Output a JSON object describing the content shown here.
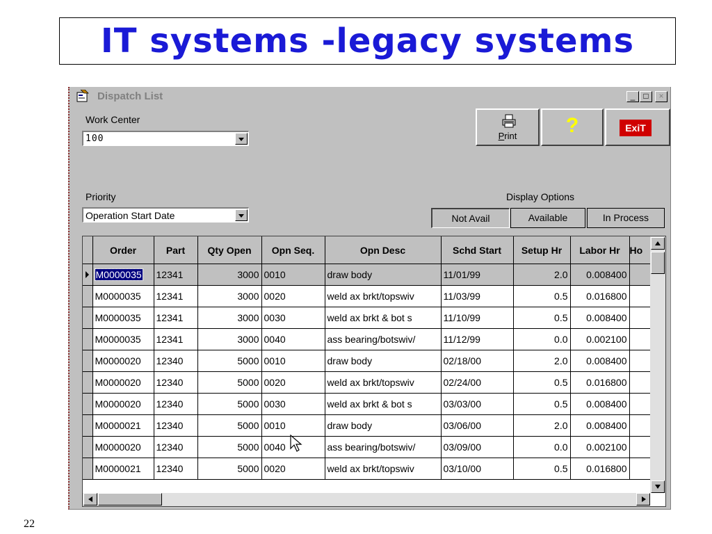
{
  "slide": {
    "title": "IT systems -legacy systems",
    "page_number": "22"
  },
  "window": {
    "title": "Dispatch List",
    "controls": {
      "minimize": "_",
      "maximize": "□",
      "close": "×"
    }
  },
  "work_center": {
    "label": "Work Center",
    "value": "100"
  },
  "priority": {
    "label": "Priority",
    "value": "Operation Start Date"
  },
  "toolbar": {
    "print_label_first": "P",
    "print_label_rest": "rint",
    "help_label": "?",
    "exit_label": "ExiT"
  },
  "display_options": {
    "label": "Display Options",
    "buttons": [
      "Not Avail",
      "Available",
      "In Process"
    ]
  },
  "grid": {
    "columns": [
      "Order",
      "Part",
      "Qty Open",
      "Opn Seq.",
      "Opn Desc",
      "Schd Start",
      "Setup Hr",
      "Labor Hr",
      "Ho"
    ],
    "rows": [
      [
        "M0000035",
        "12341",
        "3000",
        "0010",
        "draw body",
        "11/01/99",
        "2.0",
        "0.008400"
      ],
      [
        "M0000035",
        "12341",
        "3000",
        "0020",
        "weld ax brkt/topswiv",
        "11/03/99",
        "0.5",
        "0.016800"
      ],
      [
        "M0000035",
        "12341",
        "3000",
        "0030",
        "weld ax brkt & bot s",
        "11/10/99",
        "0.5",
        "0.008400"
      ],
      [
        "M0000035",
        "12341",
        "3000",
        "0040",
        "ass bearing/botswiv/",
        "11/12/99",
        "0.0",
        "0.002100"
      ],
      [
        "M0000020",
        "12340",
        "5000",
        "0010",
        "draw body",
        "02/18/00",
        "2.0",
        "0.008400"
      ],
      [
        "M0000020",
        "12340",
        "5000",
        "0020",
        "weld ax brkt/topswiv",
        "02/24/00",
        "0.5",
        "0.016800"
      ],
      [
        "M0000020",
        "12340",
        "5000",
        "0030",
        "weld ax brkt & bot s",
        "03/03/00",
        "0.5",
        "0.008400"
      ],
      [
        "M0000021",
        "12340",
        "5000",
        "0010",
        "draw body",
        "03/06/00",
        "2.0",
        "0.008400"
      ],
      [
        "M0000020",
        "12340",
        "5000",
        "0040",
        "ass bearing/botswiv/",
        "03/09/00",
        "0.0",
        "0.002100"
      ],
      [
        "M0000021",
        "12340",
        "5000",
        "0020",
        "weld ax brkt/topswiv",
        "03/10/00",
        "0.5",
        "0.016800"
      ]
    ]
  },
  "icons": {
    "app": "form-icon",
    "print": "printer-icon",
    "cursor": "mouse-pointer-icon"
  },
  "colors": {
    "title": "#1a1ad6",
    "selection": "#000080",
    "exit_bg": "#d00000",
    "help_fg": "#ffff00",
    "face": "#c0c0c0"
  }
}
